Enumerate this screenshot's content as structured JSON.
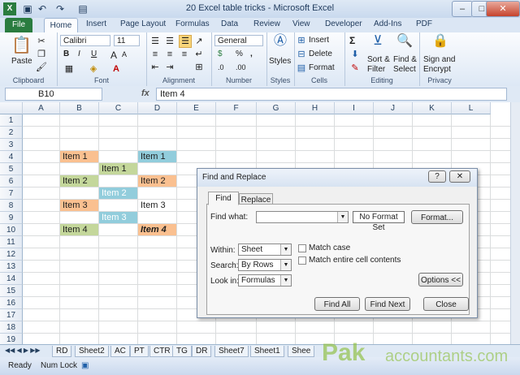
{
  "window": {
    "title": "20 Excel table tricks  -  Microsoft Excel",
    "controls": {
      "minimize": "–",
      "maximize": "□",
      "close": "✕"
    }
  },
  "qat": {
    "icons": [
      "excel-icon",
      "save-icon",
      "undo-icon",
      "redo-icon",
      "form-icon"
    ]
  },
  "tabs": [
    "File",
    "Home",
    "Insert",
    "Page Layout",
    "Formulas",
    "Data",
    "Review",
    "View",
    "Developer",
    "Add-Ins",
    "PDF"
  ],
  "ribbon": {
    "clipboard": {
      "label": "Clipboard",
      "paste": "Paste"
    },
    "font": {
      "label": "Font",
      "family": "Calibri",
      "size": "11",
      "bold": "B",
      "italic": "I",
      "underline": "U",
      "grow": "A",
      "shrink": "A"
    },
    "alignment": {
      "label": "Alignment"
    },
    "number": {
      "label": "Number",
      "format": "General",
      "currency": "$",
      "percent": "%",
      "comma": ",",
      "inc": ".0",
      "dec": ".00"
    },
    "styles": {
      "label": "Styles",
      "button": "Styles"
    },
    "cells": {
      "label": "Cells",
      "insert": "Insert",
      "delete": "Delete",
      "format": "Format"
    },
    "editing": {
      "label": "Editing",
      "sum": "Σ",
      "sort": "Sort &",
      "filter": "Filter",
      "find": "Find &",
      "select": "Select"
    },
    "privacy": {
      "label": "Privacy",
      "sign": "Sign and",
      "encrypt": "Encrypt"
    }
  },
  "formula_bar": {
    "name_box": "B10",
    "fx": "fx",
    "value": "Item 4"
  },
  "columns": [
    "A",
    "B",
    "C",
    "D",
    "E",
    "F",
    "G",
    "H",
    "I",
    "J",
    "K",
    "L"
  ],
  "rows": [
    "1",
    "2",
    "3",
    "4",
    "5",
    "6",
    "7",
    "8",
    "9",
    "10",
    "11",
    "12",
    "13",
    "14",
    "15",
    "16",
    "17",
    "18",
    "19"
  ],
  "cells": {
    "B4": "Item 1",
    "B6": "Item 2",
    "B8": "Item 3",
    "B10": "Item 4",
    "C5": "Item 1",
    "C7": "Item 2",
    "C9": "Item 3",
    "D4": "Item 1",
    "D6": "Item 2",
    "D8": "Item 3",
    "D10": "Item 4"
  },
  "sheet_tabs": [
    "RD",
    "Sheet2",
    "AC",
    "PT",
    "CTR",
    "TG",
    "DR",
    "Sheet7",
    "Sheet1",
    "Shee"
  ],
  "status": {
    "ready": "Ready",
    "numlock": "Num Lock"
  },
  "dialog": {
    "title": "Find and Replace",
    "help": "?",
    "close": "✕",
    "tabs": [
      "Find",
      "Replace"
    ],
    "find_what_label": "Find what:",
    "find_what_value": "",
    "no_format": "No Format Set",
    "format_button": "Format...",
    "within_label": "Within:",
    "within_value": "Sheet",
    "search_label": "Search:",
    "search_value": "By Rows",
    "lookin_label": "Look in:",
    "lookin_value": "Formulas",
    "match_case": "Match case",
    "match_entire": "Match entire cell contents",
    "options_button": "Options <<",
    "find_all": "Find All",
    "find_next": "Find Next",
    "close_button": "Close"
  },
  "watermark": {
    "brand": "Pak",
    "rest": "accountants.com"
  }
}
